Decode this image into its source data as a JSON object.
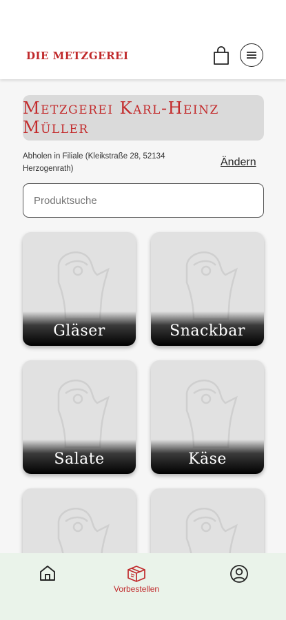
{
  "header": {
    "brand": "DIE METZGEREI",
    "cart_icon": "shopping-bag-icon",
    "menu_icon": "menu-icon"
  },
  "store": {
    "name": "Metzgerei Karl-Heinz Müller",
    "pickup": "Abholen in Filiale (Kleikstraße 28, 52134 Herzogenrath)",
    "change_label": "Ändern"
  },
  "search": {
    "placeholder": "Produktsuche",
    "value": ""
  },
  "categories": [
    {
      "label": "Gläser"
    },
    {
      "label": "Snackbar"
    },
    {
      "label": "Salate"
    },
    {
      "label": "Käse"
    },
    {
      "label": ""
    },
    {
      "label": ""
    }
  ],
  "bottom_nav": {
    "home_icon": "home-icon",
    "preorder_label": "Vorbestellen",
    "preorder_icon": "package-icon",
    "profile_icon": "profile-icon"
  },
  "colors": {
    "brand_red": "#c0292b",
    "nav_background": "#eaf3ea",
    "tile_background": "#e1e1e1"
  }
}
